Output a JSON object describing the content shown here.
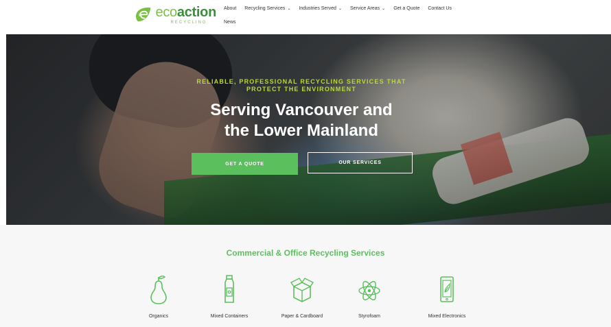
{
  "brand": {
    "name_part1": "eco",
    "name_part2": "action",
    "subtitle": "RECYCLING",
    "accent": "#5cbf5e",
    "accent_dark": "#3b8f3c"
  },
  "nav": {
    "items": [
      {
        "label": "About",
        "dropdown": false
      },
      {
        "label": "Recycling Services",
        "dropdown": true
      },
      {
        "label": "Industries Served",
        "dropdown": true
      },
      {
        "label": "Service Areas",
        "dropdown": true
      },
      {
        "label": "Get a Quote",
        "dropdown": false
      },
      {
        "label": "Contact Us",
        "dropdown": false
      }
    ],
    "row2": [
      {
        "label": "News",
        "dropdown": false
      }
    ]
  },
  "hero": {
    "tagline": "RELIABLE, PROFESSIONAL RECYCLING SERVICES THAT PROTECT THE ENVIRONMENT",
    "title_line1": "Serving Vancouver and",
    "title_line2": "the Lower Mainland",
    "primary_button": "GET A QUOTE",
    "secondary_button": "OUR SERVICES",
    "tagline_color": "#b9d93c"
  },
  "services": {
    "title": "Commercial & Office Recycling Services",
    "items": [
      {
        "label": "Organics",
        "icon": "pear-icon"
      },
      {
        "label": "Mixed Containers",
        "icon": "bottle-icon"
      },
      {
        "label": "Paper & Cardboard",
        "icon": "box-icon"
      },
      {
        "label": "Styrofoam",
        "icon": "atom-icon"
      },
      {
        "label": "Mixed Electronics",
        "icon": "phone-icon"
      }
    ]
  }
}
